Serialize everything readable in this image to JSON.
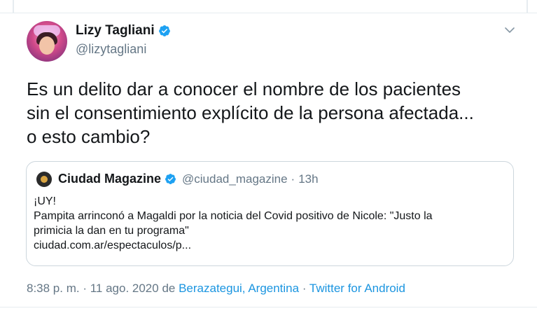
{
  "author": {
    "name": "Lizy Tagliani",
    "handle": "@lizytagliani"
  },
  "tweet": {
    "lines": [
      "Es un delito dar a conocer el nombre de los pacientes",
      "sin el consentimiento explícito de la persona afectada...",
      "o esto cambio?"
    ]
  },
  "quoted": {
    "name": "Ciudad Magazine",
    "handle": "@ciudad_magazine",
    "separator": "·",
    "time": "13h",
    "lines": [
      "¡UY!",
      "Pampita arrinconó a Magaldi por la noticia del Covid positivo de Nicole: \"Justo la",
      "primicia la dan en tu programa\"",
      "ciudad.com.ar/espectaculos/p..."
    ]
  },
  "meta": {
    "time": "8:38 p. m.",
    "sep1": " · ",
    "date": "11 ago. 2020",
    "from_label": " de ",
    "location": "Berazategui, Argentina",
    "sep2": " · ",
    "source": "Twitter for Android"
  },
  "colors": {
    "link": "#1b95e0",
    "verified": "#1da1f2",
    "muted": "#657786"
  }
}
